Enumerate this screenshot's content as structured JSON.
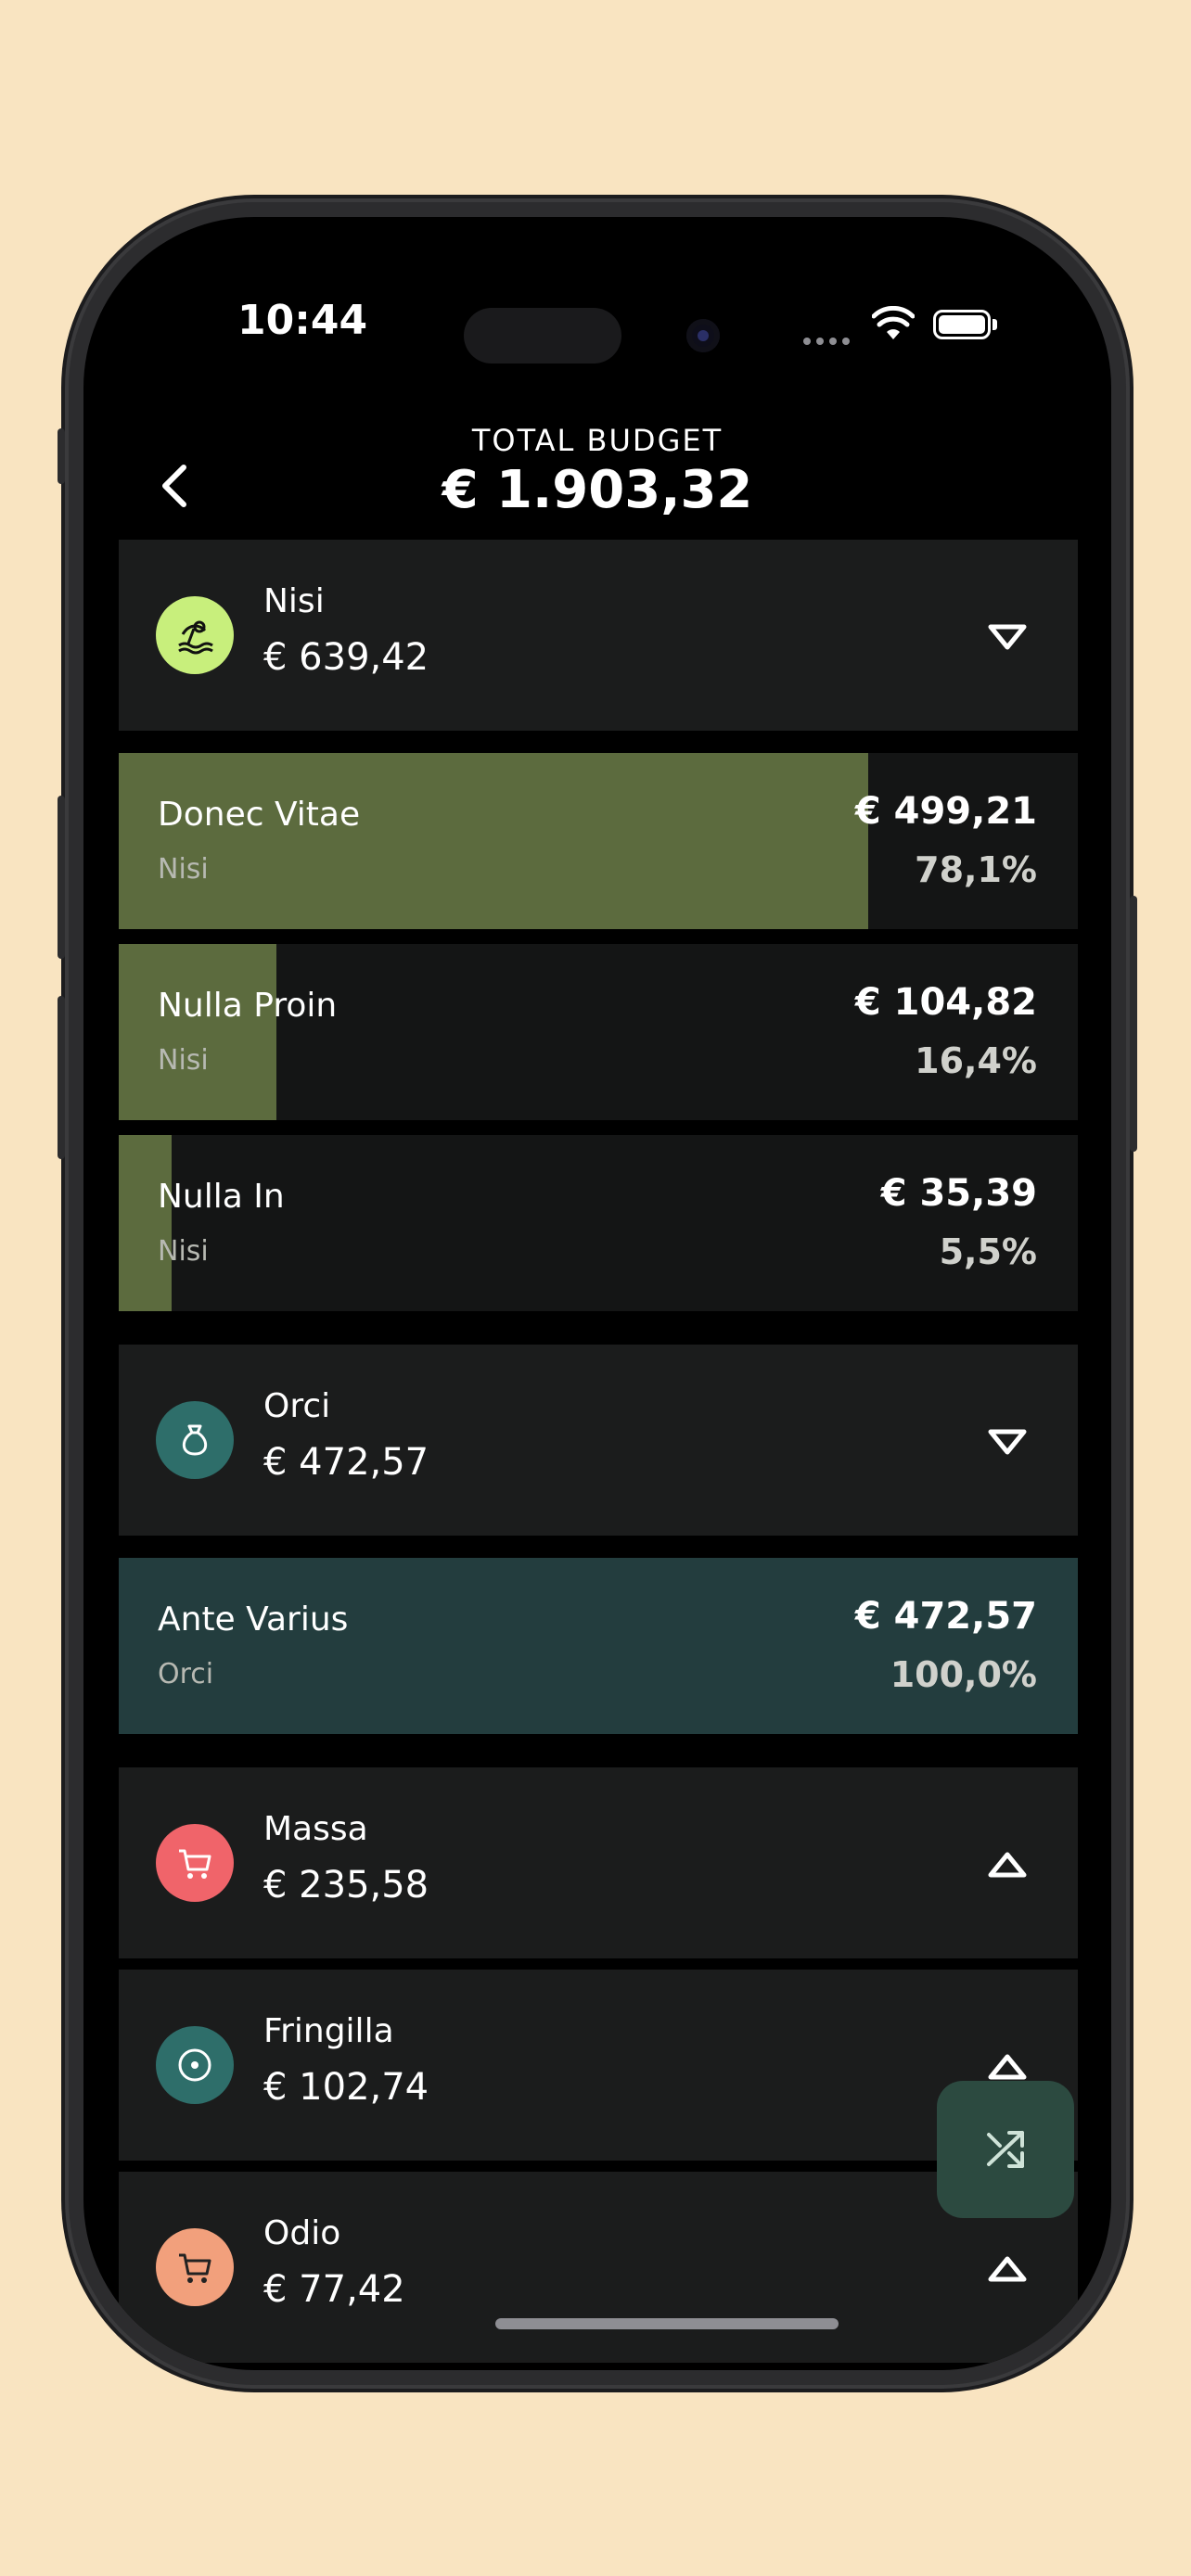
{
  "status_bar": {
    "time": "10:44"
  },
  "header": {
    "title": "TOTAL BUDGET",
    "amount": "€ 1.903,32"
  },
  "groups": [
    {
      "name": "Nisi",
      "amount": "€ 639,42",
      "icon": "beach-icon",
      "icon_color": "#c8ef7c",
      "expanded": true,
      "items": [
        {
          "name": "Donec Vitae",
          "parent": "Nisi",
          "amount": "€ 499,21",
          "percent": "78,1%",
          "fill_fraction": 0.781,
          "fill_color": "#5c6b3e"
        },
        {
          "name": "Nulla Proin",
          "parent": "Nisi",
          "amount": "€ 104,82",
          "percent": "16,4%",
          "fill_fraction": 0.164,
          "fill_color": "#5c6b3e"
        },
        {
          "name": "Nulla In",
          "parent": "Nisi",
          "amount": "€ 35,39",
          "percent": "5,5%",
          "fill_fraction": 0.055,
          "fill_color": "#5c6b3e"
        }
      ]
    },
    {
      "name": "Orci",
      "amount": "€ 472,57",
      "icon": "money-bag-icon",
      "icon_color": "#2e6e6a",
      "expanded": true,
      "items": [
        {
          "name": "Ante Varius",
          "parent": "Orci",
          "amount": "€ 472,57",
          "percent": "100,0%",
          "fill_fraction": 1.0,
          "fill_color": "#233d3e"
        }
      ]
    },
    {
      "name": "Massa",
      "amount": "€ 235,58",
      "icon": "cart-icon",
      "icon_color": "#f0646a",
      "expanded": false
    },
    {
      "name": "Fringilla",
      "amount": "€ 102,74",
      "icon": "target-icon",
      "icon_color": "#2e6e6a",
      "expanded": false
    },
    {
      "name": "Odio",
      "amount": "€ 77,42",
      "icon": "cart-icon",
      "icon_color": "#f2a07c",
      "expanded": false
    }
  ],
  "fab": {
    "icon": "shuffle-icon"
  }
}
